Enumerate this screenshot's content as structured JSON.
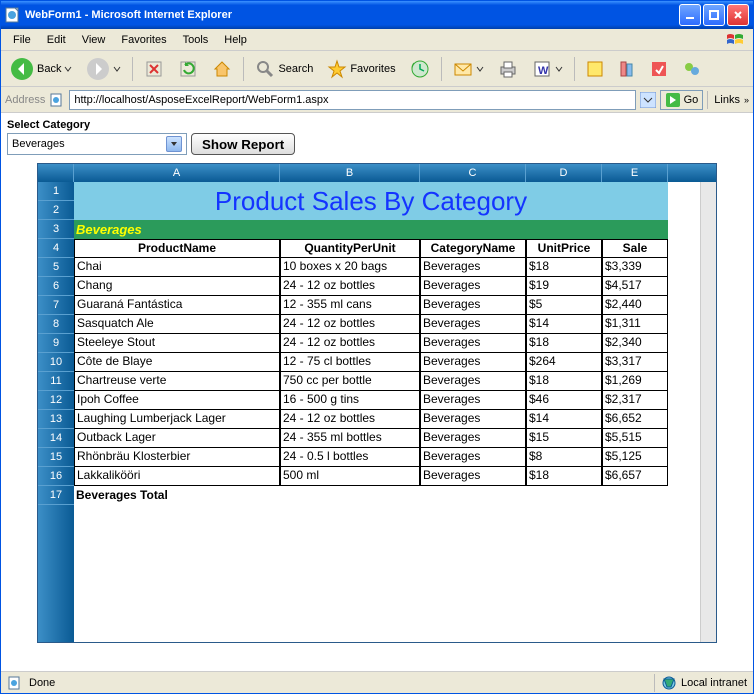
{
  "window": {
    "title": "WebForm1 - Microsoft Internet Explorer"
  },
  "menu": {
    "file": "File",
    "edit": "Edit",
    "view": "View",
    "favorites": "Favorites",
    "tools": "Tools",
    "help": "Help"
  },
  "toolbar": {
    "back": "Back",
    "search": "Search",
    "favorites": "Favorites"
  },
  "address": {
    "label": "Address",
    "url": "http://localhost/AsposeExcelReport/WebForm1.aspx",
    "go": "Go",
    "links": "Links"
  },
  "form": {
    "select_label": "Select Category",
    "selected_category": "Beverages",
    "show_btn": "Show Report"
  },
  "grid": {
    "columns": [
      "A",
      "B",
      "C",
      "D",
      "E"
    ],
    "rows": [
      "1",
      "2",
      "3",
      "4",
      "5",
      "6",
      "7",
      "8",
      "9",
      "10",
      "11",
      "12",
      "13",
      "14",
      "15",
      "16",
      "17"
    ],
    "title": "Product Sales By Category",
    "category": "Beverages",
    "headers": {
      "c1": "ProductName",
      "c2": "QuantityPerUnit",
      "c3": "CategoryName",
      "c4": "UnitPrice",
      "c5": "Sale"
    },
    "data": [
      {
        "p": "Chai",
        "q": "10 boxes x 20 bags",
        "c": "Beverages",
        "u": "$18",
        "s": "$3,339"
      },
      {
        "p": "Chang",
        "q": "24 - 12 oz bottles",
        "c": "Beverages",
        "u": "$19",
        "s": "$4,517"
      },
      {
        "p": "Guaraná Fantástica",
        "q": "12 - 355 ml cans",
        "c": "Beverages",
        "u": "$5",
        "s": "$2,440"
      },
      {
        "p": "Sasquatch Ale",
        "q": "24 - 12 oz bottles",
        "c": "Beverages",
        "u": "$14",
        "s": "$1,311"
      },
      {
        "p": "Steeleye Stout",
        "q": "24 - 12 oz bottles",
        "c": "Beverages",
        "u": "$18",
        "s": "$2,340"
      },
      {
        "p": "Côte de Blaye",
        "q": "12 - 75 cl bottles",
        "c": "Beverages",
        "u": "$264",
        "s": "$3,317"
      },
      {
        "p": "Chartreuse verte",
        "q": "750 cc per bottle",
        "c": "Beverages",
        "u": "$18",
        "s": "$1,269"
      },
      {
        "p": "Ipoh Coffee",
        "q": "16 - 500 g tins",
        "c": "Beverages",
        "u": "$46",
        "s": "$2,317"
      },
      {
        "p": "Laughing Lumberjack Lager",
        "q": "24 - 12 oz bottles",
        "c": "Beverages",
        "u": "$14",
        "s": "$6,652"
      },
      {
        "p": "Outback Lager",
        "q": "24 - 355 ml bottles",
        "c": "Beverages",
        "u": "$15",
        "s": "$5,515"
      },
      {
        "p": "Rhönbräu Klosterbier",
        "q": "24 - 0.5 l bottles",
        "c": "Beverages",
        "u": "$8",
        "s": "$5,125"
      },
      {
        "p": "Lakkalikööri",
        "q": "500 ml",
        "c": "Beverages",
        "u": "$18",
        "s": "$6,657"
      }
    ],
    "total_label": "Beverages Total"
  },
  "status": {
    "done": "Done",
    "zone": "Local intranet"
  }
}
